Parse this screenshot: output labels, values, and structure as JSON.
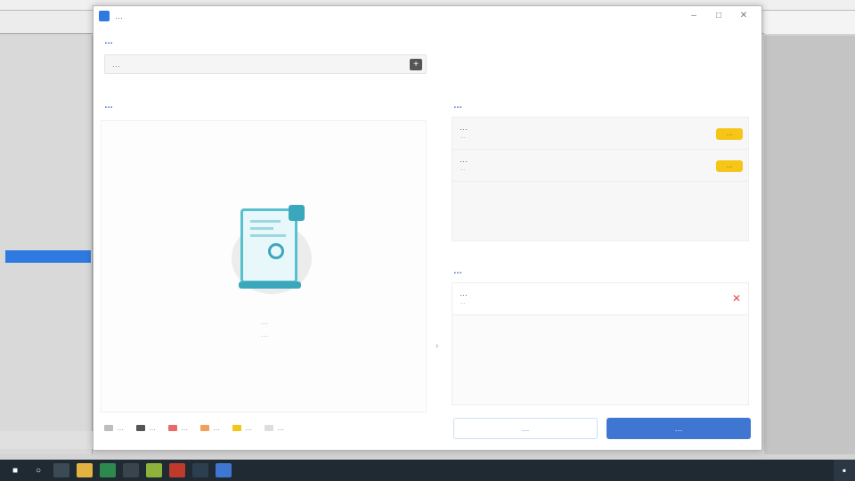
{
  "dialog": {
    "title": "…",
    "section_source": "…",
    "select_placeholder": "…",
    "section_preview": "…",
    "hint_line1": "…",
    "hint_line2": "…",
    "legend": [
      {
        "label": "…",
        "color": "#bdbdbd"
      },
      {
        "label": "…",
        "color": "#555555"
      },
      {
        "label": "…",
        "color": "#e86a6a"
      },
      {
        "label": "…",
        "color": "#f0a05a"
      },
      {
        "label": "…",
        "color": "#f5c518"
      },
      {
        "label": "…",
        "color": "#dddddd"
      }
    ],
    "section_selected": "…",
    "selected_items": [
      {
        "title": "…",
        "sub": "…",
        "badge": "…"
      },
      {
        "title": "…",
        "sub": "…",
        "badge": "…"
      }
    ],
    "section_targets": "…",
    "target_items": [
      {
        "title": "…",
        "sub": "…"
      }
    ],
    "cancel_label": "…",
    "confirm_label": "…"
  },
  "colors": {
    "accent": "#3f76d2",
    "badge": "#f5c518",
    "illustration": "#3aa7bc",
    "remove": "#e04a4a",
    "section": "#2f5fb8"
  },
  "icons": {
    "app": "app-icon",
    "minimize": "minimize-icon",
    "maximize": "maximize-icon",
    "close": "close-icon",
    "dropdown": "add-icon",
    "remove": "remove-icon"
  }
}
